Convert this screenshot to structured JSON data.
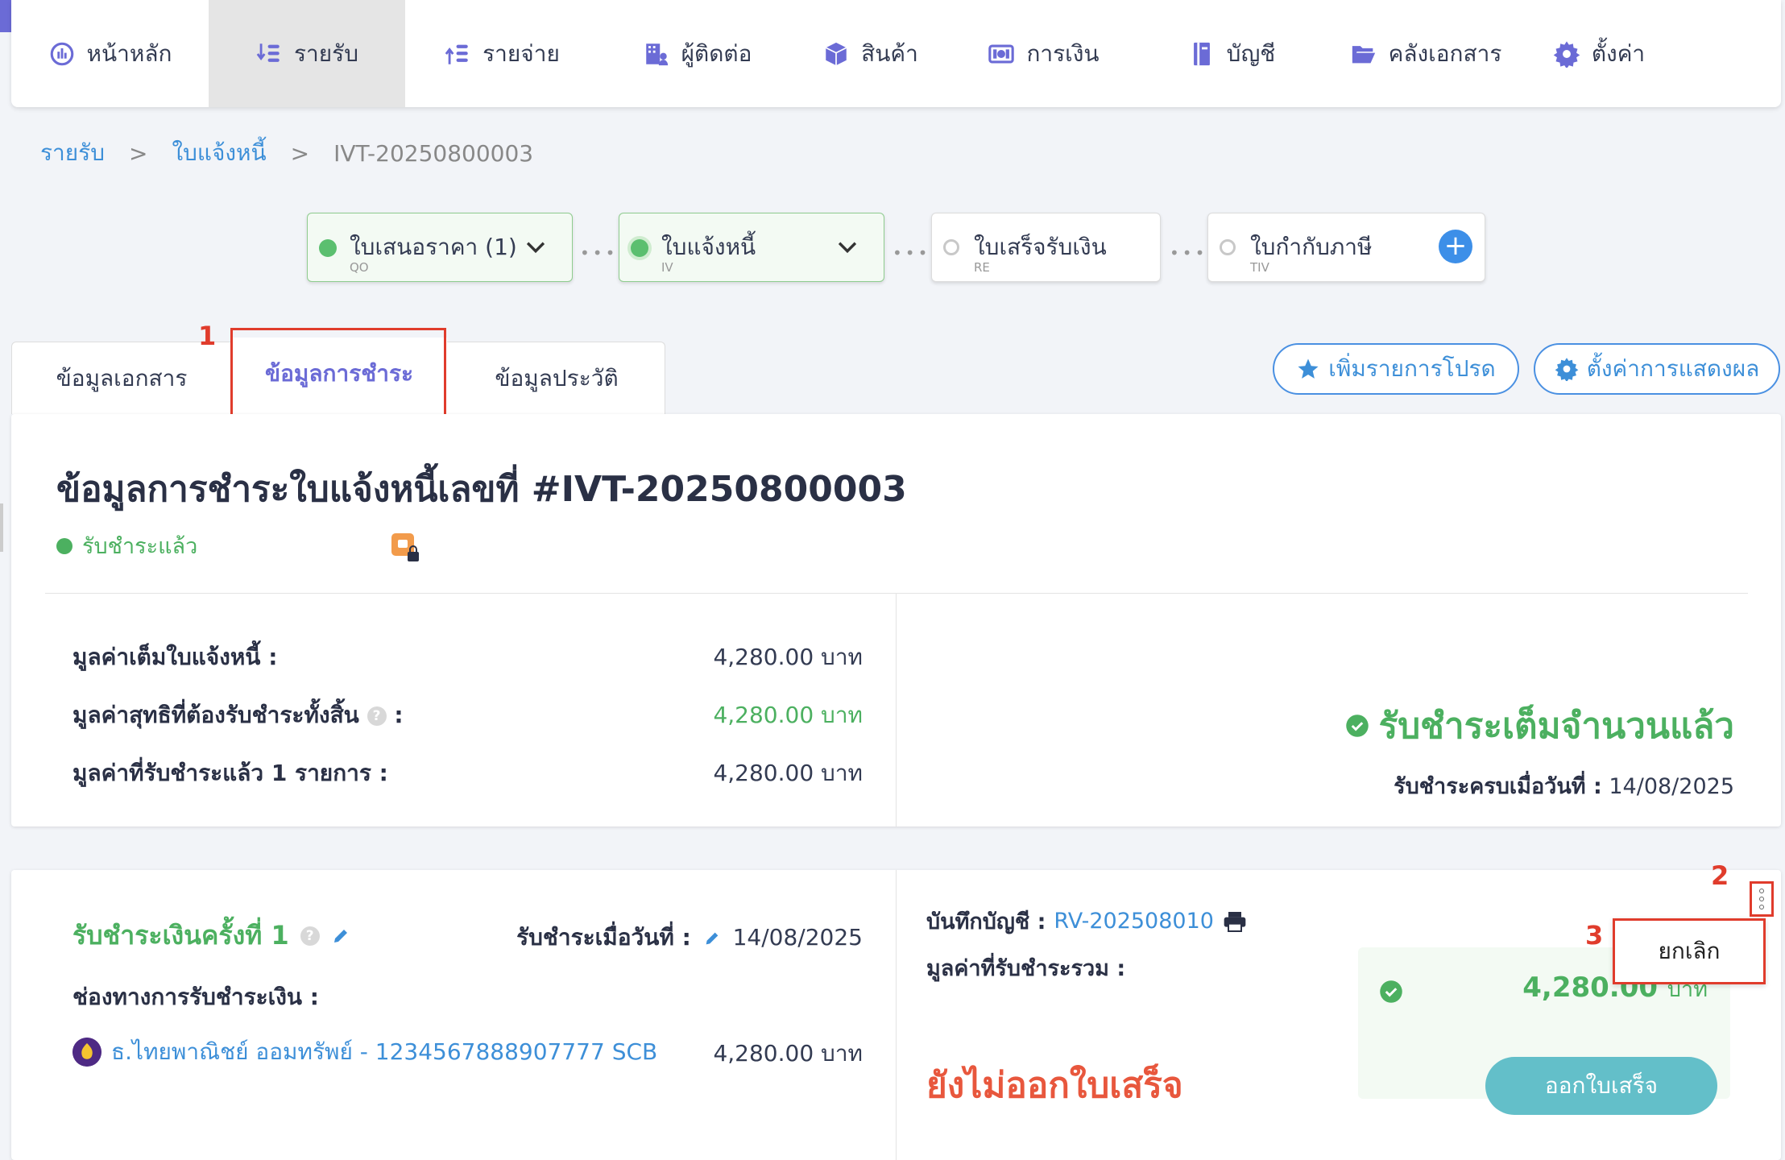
{
  "nav": {
    "items": [
      {
        "label": "หน้าหลัก",
        "icon": "dashboard-icon"
      },
      {
        "label": "รายรับ",
        "icon": "income-icon"
      },
      {
        "label": "รายจ่าย",
        "icon": "expense-icon"
      },
      {
        "label": "ผู้ติดต่อ",
        "icon": "contacts-icon"
      },
      {
        "label": "สินค้า",
        "icon": "box-icon"
      },
      {
        "label": "การเงิน",
        "icon": "money-icon"
      },
      {
        "label": "บัญชี",
        "icon": "ledger-icon"
      },
      {
        "label": "คลังเอกสาร",
        "icon": "folder-icon"
      },
      {
        "label": "ตั้งค่า",
        "icon": "gear-icon"
      }
    ],
    "active_index": 1
  },
  "breadcrumb": {
    "level1": "รายรับ",
    "level2": "ใบแจ้งหนี้",
    "current": "IVT-20250800003",
    "sep": ">"
  },
  "flow": {
    "steps": [
      {
        "label": "ใบเสนอราคา (1)",
        "code": "QO",
        "state": "done"
      },
      {
        "label": "ใบแจ้งหนี้",
        "code": "IV",
        "state": "done"
      },
      {
        "label": "ใบเสร็จรับเงิน",
        "code": "RE",
        "state": "empty"
      },
      {
        "label": "ใบกำกับภาษี",
        "code": "TIV",
        "state": "empty"
      }
    ],
    "connector": "•••",
    "add_label": "+"
  },
  "tabs": {
    "items": [
      "ข้อมูลเอกสาร",
      "ข้อมูลการชำระ",
      "ข้อมูลประวัติ"
    ],
    "active_index": 1
  },
  "actions": {
    "favorite_label": "เพิ่มรายการโปรด",
    "display_settings_label": "ตั้งค่าการแสดงผล"
  },
  "annotations": {
    "a1": "1",
    "a2": "2",
    "a3": "3"
  },
  "summary": {
    "title": "ข้อมูลการชำระใบแจ้งหนี้เลขที่ #IVT-20250800003",
    "status": "รับชำระแล้ว",
    "rows": [
      {
        "label": "มูลค่าเต็มใบแจ้งหนี้ :",
        "value": "4,280.00 บาท"
      },
      {
        "label": "มูลค่าสุทธิที่ต้องรับชำระทั้งสิ้น",
        "value": "4,280.00 บาท"
      },
      {
        "label": "มูลค่าที่รับชำระแล้ว 1 รายการ :",
        "value": "4,280.00 บาท"
      }
    ],
    "help_glyph": "?",
    "colon": ":",
    "full_paid_text": "รับชำระเต็มจำนวนแล้ว",
    "paid_date_label": "รับชำระครบเมื่อวันที่ :",
    "paid_date_value": "14/08/2025"
  },
  "payment": {
    "title": "รับชำระเงินครั้งที่ 1",
    "date_label": "รับชำระเมื่อวันที่ :",
    "date_value": "14/08/2025",
    "channel_label": "ช่องทางการรับชำระเงิน :",
    "bank_name": "ธ.ไทยพาณิชย์ ออมทรัพย์ - 1234567888907777 SCB",
    "bank_amount": "4,280.00 บาท",
    "account_label": "บันทึกบัญชี :",
    "account_value": "RV-202508010",
    "sum_label": "มูลค่าที่รับชำระรวม :",
    "sum_amount": "4,280.00",
    "sum_unit": "บาท",
    "no_receipt_text": "ยังไม่ออกใบเสร็จ",
    "issue_receipt_label": "ออกใบเสร็จ",
    "menu_cancel_label": "ยกเลิก"
  },
  "colors": {
    "brand_purple": "#6b6bd6",
    "link_blue": "#3d8fd8",
    "success_green": "#4cb060",
    "warning_orange": "#e8573d",
    "annotation_red": "#e03c2c",
    "teal_button": "#63bfc9"
  }
}
